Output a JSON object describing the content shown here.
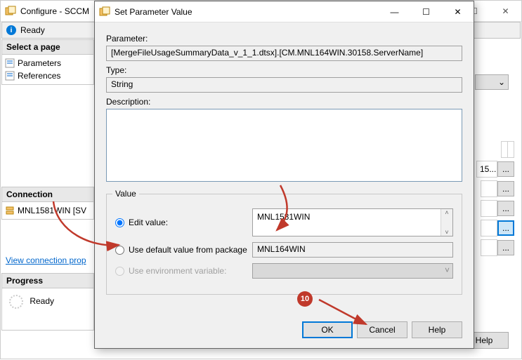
{
  "bg": {
    "title": "Configure - SCCM",
    "readyBar": "Ready",
    "selectPage": "Select a page",
    "pages": [
      "Parameters",
      "References"
    ],
    "connectionHead": "Connection",
    "server": "MNL1581WIN [SV",
    "viewConn": "View connection prop",
    "progressHead": "Progress",
    "progressText": "Ready",
    "gridText": "15...",
    "helpBtn": "Help",
    "comboChevron": "⌄"
  },
  "dlg": {
    "title": "Set Parameter Value",
    "paramLabel": "Parameter:",
    "paramValue": "[MergeFileUsageSummaryData_v_1_1.dtsx].[CM.MNL164WIN.30158.ServerName]",
    "typeLabel": "Type:",
    "typeValue": "String",
    "descLabel": "Description:",
    "descValue": "",
    "groupTitle": "Value",
    "editRadio": "Edit value:",
    "editValue": "MNL1581WIN",
    "defaultRadio": "Use default value from package",
    "defaultValue": "MNL164WIN",
    "envRadio": "Use environment variable:",
    "ok": "OK",
    "cancel": "Cancel",
    "help": "Help"
  },
  "anno": {
    "badge": "10"
  },
  "glyph": {
    "min": "—",
    "max": "☐",
    "close": "✕",
    "caretUp": "˄",
    "caretDown": "˅",
    "ellipsis": "..."
  }
}
